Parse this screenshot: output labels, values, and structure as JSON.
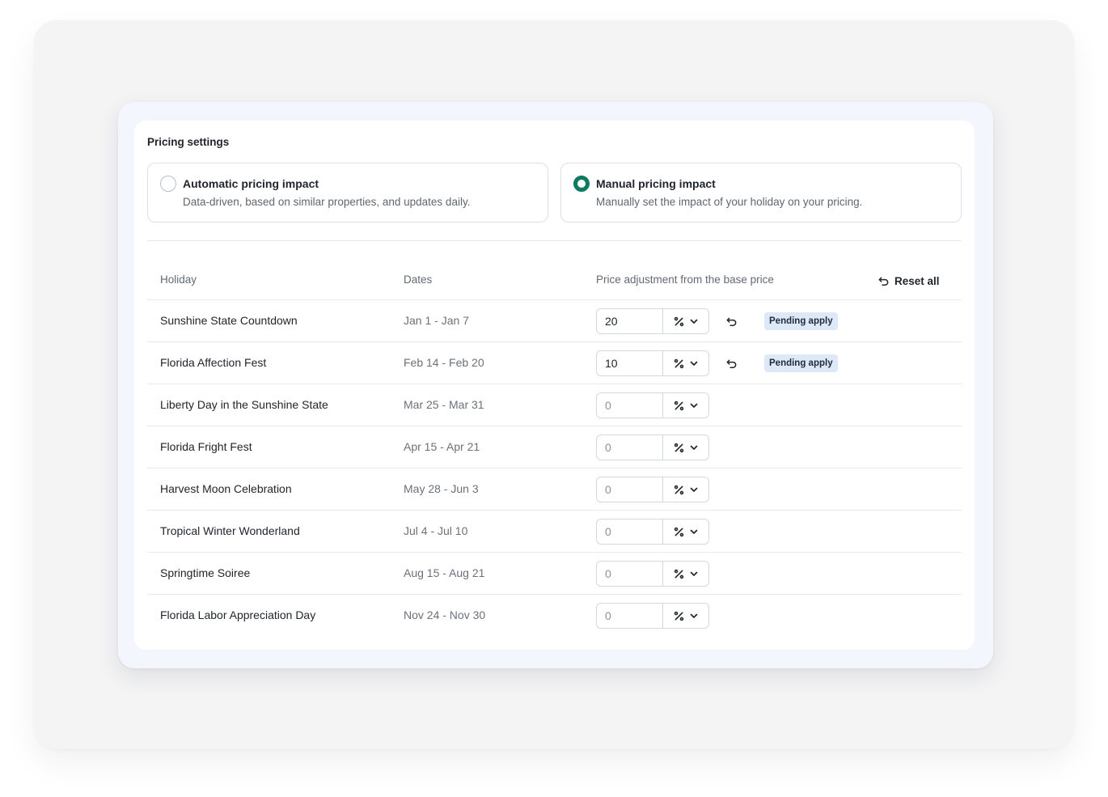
{
  "section_title": "Pricing settings",
  "options": [
    {
      "title": "Automatic pricing impact",
      "description": "Data-driven, based on similar properties, and updates daily.",
      "selected": false
    },
    {
      "title": "Manual pricing impact",
      "description": "Manually set the impact of your holiday on your pricing.",
      "selected": true
    }
  ],
  "table": {
    "headers": {
      "holiday": "Holiday",
      "dates": "Dates",
      "adjustment": "Price adjustment from the base price"
    },
    "reset_all_label": "Reset all",
    "placeholder": "0",
    "unit_icon": "percent-icon",
    "rows": [
      {
        "name": "Sunshine State Countdown",
        "dates": "Jan 1 - Jan 7",
        "value": "20",
        "status": "Pending apply"
      },
      {
        "name": "Florida Affection Fest",
        "dates": "Feb 14 - Feb 20",
        "value": "10",
        "status": "Pending apply"
      },
      {
        "name": "Liberty Day in the Sunshine State",
        "dates": "Mar 25 - Mar 31",
        "value": "",
        "status": ""
      },
      {
        "name": "Florida Fright Fest",
        "dates": "Apr 15 - Apr 21",
        "value": "",
        "status": ""
      },
      {
        "name": "Harvest Moon Celebration",
        "dates": "May 28 - Jun 3",
        "value": "",
        "status": ""
      },
      {
        "name": "Tropical Winter Wonderland",
        "dates": "Jul 4 - Jul 10",
        "value": "",
        "status": ""
      },
      {
        "name": "Springtime Soiree",
        "dates": "Aug 15 - Aug 21",
        "value": "",
        "status": ""
      },
      {
        "name": "Florida Labor Appreciation Day",
        "dates": "Nov 24 - Nov 30",
        "value": "",
        "status": ""
      }
    ]
  },
  "colors": {
    "accent": "#0e7a62",
    "badge_bg": "#dde8f8"
  }
}
